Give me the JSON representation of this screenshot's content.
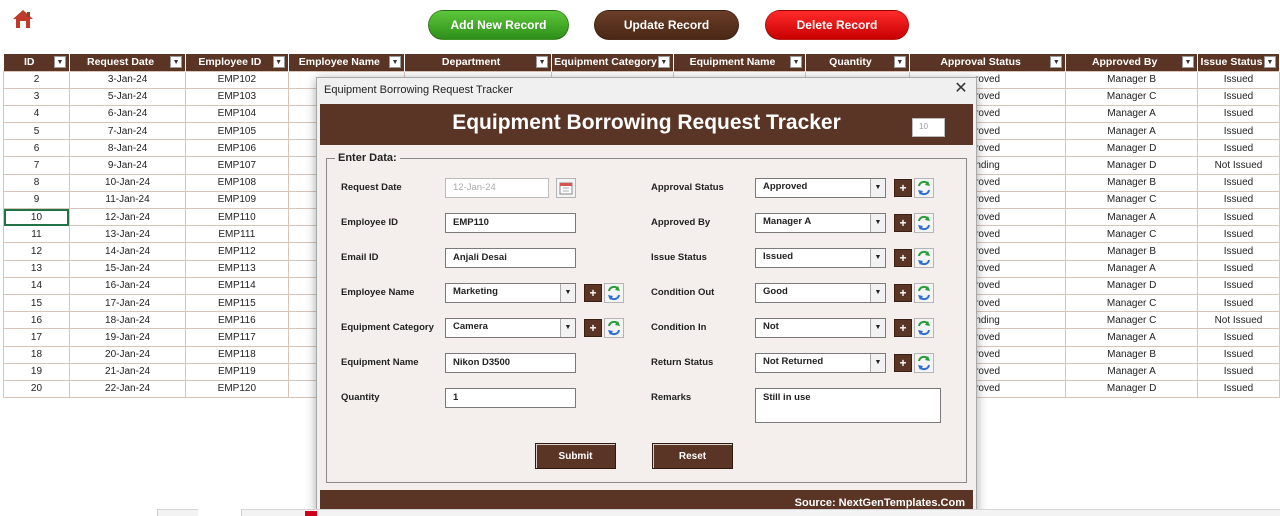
{
  "toolbar": {
    "add_label": "Add New Record",
    "update_label": "Update Record",
    "delete_label": "Delete Record",
    "home_icon": "home-icon"
  },
  "table": {
    "columns": [
      "ID",
      "Request Date",
      "Employee ID",
      "Employee Name",
      "Department",
      "Equipment Category",
      "Equipment Name",
      "Quantity",
      "Approval Status",
      "Approved By",
      "Issue Status"
    ],
    "rows": [
      [
        "2",
        "3-Jan-24",
        "EMP102",
        "",
        "",
        "",
        "",
        "",
        "roved",
        "Manager B",
        "Issued"
      ],
      [
        "3",
        "5-Jan-24",
        "EMP103",
        "",
        "",
        "",
        "",
        "",
        "roved",
        "Manager C",
        "Issued"
      ],
      [
        "4",
        "6-Jan-24",
        "EMP104",
        "",
        "",
        "",
        "",
        "",
        "roved",
        "Manager A",
        "Issued"
      ],
      [
        "5",
        "7-Jan-24",
        "EMP105",
        "",
        "",
        "",
        "",
        "",
        "roved",
        "Manager A",
        "Issued"
      ],
      [
        "6",
        "8-Jan-24",
        "EMP106",
        "",
        "",
        "",
        "",
        "",
        "roved",
        "Manager D",
        "Issued"
      ],
      [
        "7",
        "9-Jan-24",
        "EMP107",
        "",
        "",
        "",
        "",
        "",
        "nding",
        "Manager D",
        "Not Issued"
      ],
      [
        "8",
        "10-Jan-24",
        "EMP108",
        "",
        "",
        "",
        "",
        "",
        "roved",
        "Manager B",
        "Issued"
      ],
      [
        "9",
        "11-Jan-24",
        "EMP109",
        "",
        "",
        "",
        "",
        "",
        "roved",
        "Manager C",
        "Issued"
      ],
      [
        "10",
        "12-Jan-24",
        "EMP110",
        "",
        "",
        "",
        "",
        "",
        "roved",
        "Manager A",
        "Issued"
      ],
      [
        "11",
        "13-Jan-24",
        "EMP111",
        "",
        "",
        "",
        "",
        "",
        "roved",
        "Manager C",
        "Issued"
      ],
      [
        "12",
        "14-Jan-24",
        "EMP112",
        "",
        "",
        "",
        "",
        "",
        "roved",
        "Manager B",
        "Issued"
      ],
      [
        "13",
        "15-Jan-24",
        "EMP113",
        "",
        "",
        "",
        "",
        "",
        "roved",
        "Manager A",
        "Issued"
      ],
      [
        "14",
        "16-Jan-24",
        "EMP114",
        "",
        "",
        "",
        "",
        "",
        "roved",
        "Manager D",
        "Issued"
      ],
      [
        "15",
        "17-Jan-24",
        "EMP115",
        "",
        "",
        "",
        "",
        "",
        "roved",
        "Manager C",
        "Issued"
      ],
      [
        "16",
        "18-Jan-24",
        "EMP116",
        "",
        "",
        "",
        "",
        "",
        "nding",
        "Manager C",
        "Not Issued"
      ],
      [
        "17",
        "19-Jan-24",
        "EMP117",
        "",
        "",
        "",
        "",
        "",
        "roved",
        "Manager A",
        "Issued"
      ],
      [
        "18",
        "20-Jan-24",
        "EMP118",
        "",
        "",
        "",
        "",
        "",
        "roved",
        "Manager B",
        "Issued"
      ],
      [
        "19",
        "21-Jan-24",
        "EMP119",
        "",
        "",
        "",
        "",
        "",
        "roved",
        "Manager A",
        "Issued"
      ],
      [
        "20",
        "22-Jan-24",
        "EMP120",
        "",
        "",
        "",
        "",
        "",
        "roved",
        "Manager D",
        "Issued"
      ]
    ],
    "selected_row": 8
  },
  "dialog": {
    "window_title": "Equipment Borrowing Request Tracker",
    "banner_title": "Equipment Borrowing Request Tracker",
    "record_number": "10",
    "section_label": "Enter Data:",
    "fields": {
      "request_date": {
        "label": "Request Date",
        "value": "12-Jan-24"
      },
      "employee_id": {
        "label": "Employee ID",
        "value": "EMP110"
      },
      "email_id": {
        "label": "Email ID",
        "value": "Anjali Desai"
      },
      "employee_name": {
        "label": "Employee Name",
        "value": "Marketing"
      },
      "equipment_category": {
        "label": "Equipment Category",
        "value": "Camera"
      },
      "equipment_name": {
        "label": "Equipment Name",
        "value": "Nikon D3500"
      },
      "quantity": {
        "label": "Quantity",
        "value": "1"
      },
      "approval_status": {
        "label": "Approval Status",
        "value": "Approved"
      },
      "approved_by": {
        "label": "Approved By",
        "value": "Manager A"
      },
      "issue_status": {
        "label": "Issue Status",
        "value": "Issued"
      },
      "condition_out": {
        "label": "Condition Out",
        "value": "Good"
      },
      "condition_in": {
        "label": "Condition In",
        "value": "Not"
      },
      "return_status": {
        "label": "Return Status",
        "value": "Not Returned"
      },
      "remarks": {
        "label": "Remarks",
        "value": "Still in use"
      }
    },
    "plus_label": "+",
    "submit_label": "Submit",
    "reset_label": "Reset",
    "source": "Source: NextGenTemplates.Com"
  },
  "colors": {
    "brand_brown": "#5a3424",
    "add_green": "#3aa824",
    "delete_red": "#e60000",
    "selection_green": "#217346"
  }
}
